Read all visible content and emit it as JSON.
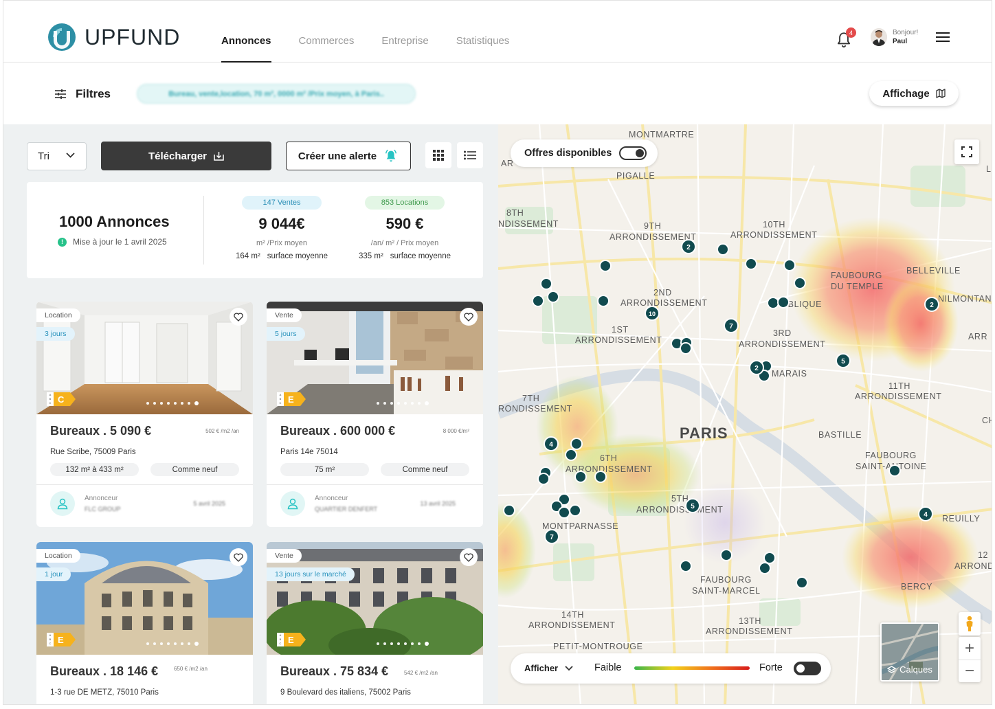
{
  "app": {
    "name": "UPFUND"
  },
  "nav": [
    {
      "label": "Annonces",
      "active": true
    },
    {
      "label": "Commerces",
      "active": false
    },
    {
      "label": "Entreprise",
      "active": false
    },
    {
      "label": "Statistiques",
      "active": false
    }
  ],
  "header": {
    "notification_count": "4",
    "greeting": "Bonjour!",
    "user_name": "Paul"
  },
  "filters": {
    "label": "Filtres",
    "chip": "Bureau, vente,location, 70  m², 0000 m² /Prix moyen, à Paris..",
    "display_label": "Affichage"
  },
  "toolbar": {
    "sort_label": "Tri",
    "download_label": "Télécharger",
    "alert_label": "Créer une alerte"
  },
  "stats": {
    "total": "1000 Annonces",
    "updated": "Mise à jour le 1 avril 2025",
    "sales": {
      "badge": "147  Ventes",
      "value": "9 044€",
      "unit": "m² /Prix moyen",
      "surface_value": "164 m²",
      "surface_label": "surface moyenne"
    },
    "rentals": {
      "badge": "853 Locations",
      "value": "590 €",
      "unit": "/an/ m² / Prix moyen",
      "surface_value": "335 m²",
      "surface_label": "surface moyenne"
    }
  },
  "listings": [
    {
      "type": "Location",
      "age": "3 jours",
      "energy": "C",
      "title": "Bureaux . 5 090 €",
      "price_unit": "502 € /m2 /an",
      "address": "Rue Scribe, 75009 Paris",
      "surface": "132 m²  à 433 m²",
      "condition": "Comme neuf",
      "advertiser_label": "Annonceur",
      "advertiser": "FLC GROUP",
      "date": "5 avril 2025"
    },
    {
      "type": "Vente",
      "age": "5 jours",
      "energy": "E",
      "title": "Bureaux . 600 000 €",
      "price_unit": "8 000 €/m²",
      "address": "Paris 14e 75014",
      "surface": "75 m²",
      "condition": "Comme neuf",
      "advertiser_label": "Annonceur",
      "advertiser": "QUARTIER DENFERT",
      "date": "13 avril 2025"
    },
    {
      "type": "Location",
      "age": "1 jour",
      "energy": "E",
      "title": "Bureaux . 18 146 €",
      "price_unit": "650 € /m2 /an",
      "address": "1-3 rue DE METZ, 75010 Paris"
    },
    {
      "type": "Vente",
      "age": "13 jours sur le marché",
      "energy": "E",
      "title": "Bureaux . 75 834 €",
      "price_unit": "542 € /m2 /an",
      "address": "9 Boulevard des italiens, 75002 Paris"
    }
  ],
  "map": {
    "available_label": "Offres disponibles",
    "legend": {
      "show_label": "Afficher",
      "low": "Faible",
      "high": "Forte"
    },
    "layers_label": "Calques",
    "labels": {
      "montmartre": "MONTMARTRE",
      "pigalle": "PIGALLE",
      "ar_top": "AR",
      "l8": "8TH",
      "l8b": "NDISSEMENT",
      "l9": "9TH",
      "l9b": "ARRONDISSEMENT",
      "l10": "10TH",
      "l10b": "ARRONDISSEMENT",
      "fdt": "FAUBOURG",
      "fdtb": "DU TEMPLE",
      "belleville": "BELLEVILLE",
      "menil": "NILMONTAN",
      "arr_right": "ARR",
      "l_right": "L",
      "l2": "2ND",
      "l2b": "ARRONDISSEMENT",
      "republique": "UBLIQUE",
      "l1": "1ST",
      "l1b": "ARRONDISSEMENT",
      "l3": "3RD",
      "l3b": "ARRONDISSEMENT",
      "marais": "MARAIS",
      "l11": "11TH",
      "l11b": "ARRONDISSEMENT",
      "l7": "7TH",
      "l7b": "RONDISSEMENT",
      "paris": "PARIS",
      "bastille": "BASTILLE",
      "ch": "CH",
      "l6": "6TH",
      "l6b": "ARRONDISSEMENT",
      "fsa": "FAUBOURG",
      "fsab": "SAINT-ANTOINE",
      "l5": "5TH",
      "l5b": "ARRONDISSEMENT",
      "montparnasse": "MONTPARNASSE",
      "reuilly": "REUILLY",
      "l12": "12",
      "l12b": "ARROND",
      "fsm": "FAUBOURG",
      "fsmb": "SAINT-MARCEL",
      "bercy": "BERCY",
      "l14": "14TH",
      "l14b": "ARRONDISSEMENT",
      "l13": "13TH",
      "l13b": "ARRONDISSEMENT",
      "petit": "PETIT-MONTROUGE"
    },
    "clusters": [
      "2",
      "10",
      "7",
      "2",
      "5",
      "2",
      "4",
      "5",
      "4",
      "7"
    ],
    "colors": {
      "marker": "#114b4f",
      "accent": "#27c3c3"
    }
  }
}
